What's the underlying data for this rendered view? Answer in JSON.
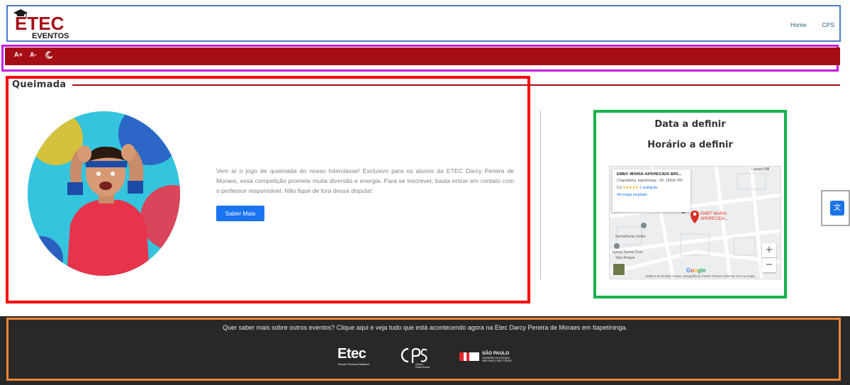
{
  "header": {
    "logo_text_main": "ETEC",
    "logo_text_sub": "EVENTOS",
    "nav": [
      {
        "label": "Home"
      },
      {
        "label": "CPS"
      }
    ]
  },
  "accessibility": {
    "increase_font": "A+",
    "decrease_font": "A-",
    "dark_mode_icon": "moon-icon"
  },
  "event": {
    "title": "Queimada",
    "description": "Vem aí o jogo de queimada do nosso Interclasse! Exclusivo para os alunos da ETEC Darcy Pereira de Moraes, essa competição promete muita diversão e energia. Para se inscrever, basta entrar em contato com o professor responsável. Não fique de fora dessa disputa!",
    "button_label": "Saber Mais",
    "date": "Data a definir",
    "time": "Horário a definir"
  },
  "map": {
    "place_name": "EMEF MARIA APARECIDA BRI...",
    "address": "Chapadinha, Itapetininga - SP, 18206-782",
    "rating": "5,0",
    "stars": "★★★★★",
    "reviews": "1 avaliação",
    "link": "Ver mapa ampliado",
    "pin_label_1": "EMEF MARIA",
    "pin_label_2": "APARECIDA...",
    "street_label_1": "Serralheria União",
    "street_label_2": "Igreja Santa Cruz",
    "street_label_3": "São Roque",
    "street_label_4": "Lazaro Mil",
    "zoom_in": "+",
    "zoom_out": "−",
    "google_g1": "G",
    "google_g2": "o",
    "google_g3": "o",
    "google_g4": "gle",
    "footer_note": "Atalhos do teclado    Dados cartográficos ©2024    Termos    Informar erro no mapa"
  },
  "translate": {
    "icon": "translate-icon",
    "glyph": "文"
  },
  "footer": {
    "text": "Quer saber mais sobre outros eventos? Clique aqui e veja tudo que está acontecendo agora na Etec Darcy Pereira de Moraes em Itapetininga.",
    "etec_logo": "Etec",
    "etec_sub": "Escola Técnica Estadual",
    "cps_sub_1": "Centro",
    "cps_sub_2": "Paula Souza",
    "sp_logo": "SÃO PAULO",
    "sp_sub_1": "GOVERNO DO ESTADO",
    "sp_sub_2": "SÃO PAULO SÃO TODOS"
  },
  "colors": {
    "brand_red": "#a50e15",
    "button_blue": "#1a73f0",
    "footer_bg": "#282828"
  }
}
